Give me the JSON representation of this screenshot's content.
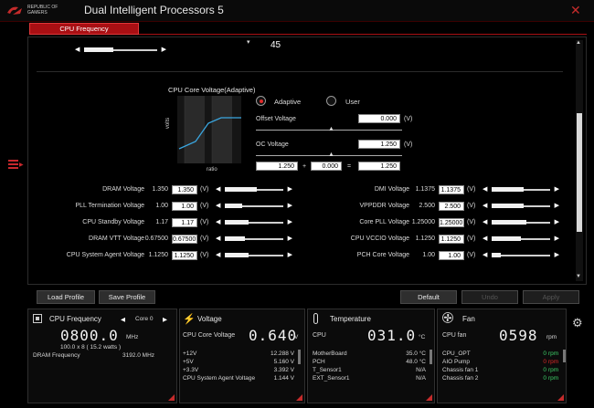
{
  "window": {
    "brand_line1": "REPUBLIC OF",
    "brand_line2": "GAMERS",
    "title": "Dual Intelligent Processors 5",
    "close_glyph": "✕"
  },
  "tabs": {
    "active": "CPU Frequency"
  },
  "top_slider": {
    "left_arrow": "◀",
    "right_arrow": "▶",
    "value_label": "45",
    "fill": 0.4
  },
  "graph": {
    "title": "CPU Core Voltage(Adaptive)",
    "ylabel": "volts",
    "xlabel": "ratio"
  },
  "mode": {
    "adaptive": "Adaptive",
    "user": "User",
    "selected": "adaptive"
  },
  "offset": {
    "label": "Offset Voltage",
    "value": "0.000",
    "unit": "(V)"
  },
  "oc": {
    "label": "OC Voltage",
    "value": "1.250",
    "unit": "(V)",
    "calc_a": "1.250",
    "plus": "+",
    "calc_b": "0.000",
    "equals": "=",
    "calc_result": "1.250"
  },
  "left_voltages": [
    {
      "label": "DRAM Voltage",
      "default": "1.350",
      "value": "1.350",
      "unit": "(V)",
      "fill": 0.55
    },
    {
      "label": "PLL Termination Voltage",
      "default": "1.00",
      "value": "1.00",
      "unit": "(V)",
      "fill": 0.3
    },
    {
      "label": "CPU Standby Voltage",
      "default": "1.17",
      "value": "1.17",
      "unit": "(V)",
      "fill": 0.4
    },
    {
      "label": "DRAM VTT Voltage",
      "default": "0.67500",
      "value": "0.67500",
      "unit": "(V)",
      "fill": 0.35
    },
    {
      "label": "CPU System Agent Voltage",
      "default": "1.1250",
      "value": "1.1250",
      "unit": "(V)",
      "fill": 0.4
    }
  ],
  "right_voltages": [
    {
      "label": "DMI Voltage",
      "default": "1.1375",
      "value": "1.1375",
      "unit": "(V)",
      "fill": 0.55
    },
    {
      "label": "VPPDDR Voltage",
      "default": "2.500",
      "value": "2.500",
      "unit": "(V)",
      "fill": 0.55
    },
    {
      "label": "Core PLL Voltage",
      "default": "1.25000",
      "value": "1.25000",
      "unit": "(V)",
      "fill": 0.6
    },
    {
      "label": "CPU VCCIO Voltage",
      "default": "1.1250",
      "value": "1.1250",
      "unit": "(V)",
      "fill": 0.5
    },
    {
      "label": "PCH Core Voltage",
      "default": "1.00",
      "value": "1.00",
      "unit": "(V)",
      "fill": 0.15
    }
  ],
  "buttons": {
    "load": "Load Profile",
    "save": "Save Profile",
    "default": "Default",
    "undo": "Undo",
    "apply": "Apply"
  },
  "status": {
    "cpu_freq": {
      "title": "CPU Frequency",
      "core_left": "◀",
      "core": "Core 0",
      "core_right": "▶",
      "value": "0800.0",
      "unit": "MHz",
      "detail": "100.0  x  8   ( 15.2   watts )",
      "dram_label": "DRAM Frequency",
      "dram_value": "3192.0  MHz"
    },
    "voltage": {
      "title": "Voltage",
      "main_label": "CPU Core Voltage",
      "main_value": "0.640",
      "main_unit": "V",
      "rows": [
        {
          "label": "+12V",
          "value": "12.288  V"
        },
        {
          "label": "+5V",
          "value": "5.160  V"
        },
        {
          "label": "+3.3V",
          "value": "3.392  V"
        },
        {
          "label": "CPU System Agent Voltage",
          "value": "1.144  V"
        }
      ]
    },
    "temperature": {
      "title": "Temperature",
      "main_label": "CPU",
      "main_value": "031.0",
      "main_unit": "°C",
      "rows": [
        {
          "label": "MotherBoard",
          "value": "35.0 °C"
        },
        {
          "label": "PCH",
          "value": "48.0 °C"
        },
        {
          "label": "T_Sensor1",
          "value": "N/A"
        },
        {
          "label": "EXT_Sensor1",
          "value": "N/A"
        }
      ]
    },
    "fan": {
      "title": "Fan",
      "main_label": "CPU fan",
      "main_value": "0598",
      "main_unit": "rpm",
      "rows": [
        {
          "label": "CPU_OPT",
          "value": "0",
          "unit": "rpm",
          "color": "#3fd26a"
        },
        {
          "label": "AIO Pump",
          "value": "0",
          "unit": "rpm",
          "color": "#e02a2a"
        },
        {
          "label": "Chassis fan 1",
          "value": "0",
          "unit": "rpm",
          "color": "#3fd26a"
        },
        {
          "label": "Chassis fan 2",
          "value": "0",
          "unit": "rpm",
          "color": "#3fd26a"
        }
      ]
    }
  },
  "colors": {
    "accent": "#a90f13",
    "graph_line": "#3aa6e0"
  }
}
